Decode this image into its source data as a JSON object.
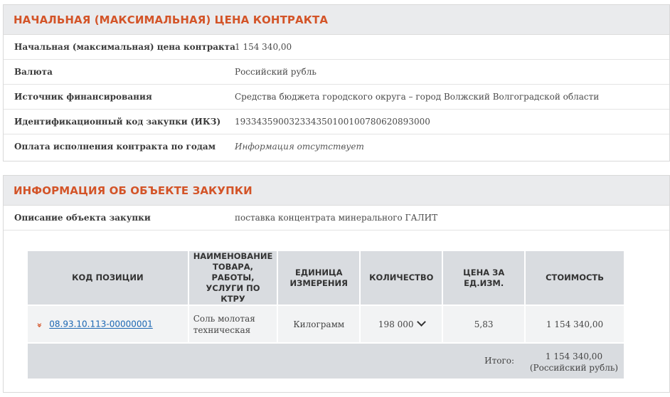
{
  "price_section": {
    "title": "НАЧАЛЬНАЯ (МАКСИМАЛЬНАЯ) ЦЕНА КОНТРАКТА",
    "rows": [
      {
        "label": "Начальная (максимальная) цена контракта",
        "value": "1 154 340,00"
      },
      {
        "label": "Валюта",
        "value": "Российский рубль"
      },
      {
        "label": "Источник финансирования",
        "value": "Средства бюджета городского округа – город Волжский Волгоградской области"
      },
      {
        "label": "Идентификационный код закупки (ИКЗ)",
        "value": "193343590032334350100100780620893000"
      },
      {
        "label": "Оплата исполнения контракта по годам",
        "value": "Информация отсутствует"
      }
    ]
  },
  "object_section": {
    "title": "ИНФОРМАЦИЯ ОБ ОБЪЕКТЕ ЗАКУПКИ",
    "description_label": "Описание объекта закупки",
    "description_value": "поставка концентрата минерального ГАЛИТ",
    "table": {
      "headers": [
        "КОД ПОЗИЦИИ",
        "НАИМЕНОВАНИЕ ТОВАРА, РАБОТЫ, УСЛУГИ ПО КТРУ",
        "ЕДИНИЦА ИЗМЕРЕНИЯ",
        "КОЛИЧЕСТВО",
        "ЦЕНА ЗА ЕД.ИЗМ.",
        "СТОИМОСТЬ"
      ],
      "rows": [
        {
          "code": "08.93.10.113-00000001",
          "name": "Соль молотая техническая",
          "unit": "Килограмм",
          "quantity": "198 000",
          "price": "5,83",
          "cost": "1 154 340,00"
        }
      ],
      "total_label": "Итого:",
      "total_value_line1": "1 154 340,00",
      "total_value_line2": "(Российский рубль)"
    }
  },
  "colors": {
    "accent": "#d35428",
    "link": "#1c67b3",
    "header_bg": "#eaebed",
    "table_header_bg": "#d9dce0"
  },
  "icons": {
    "expand": "double-chevron-down-icon",
    "quantity_toggle": "chevron-down-icon"
  }
}
